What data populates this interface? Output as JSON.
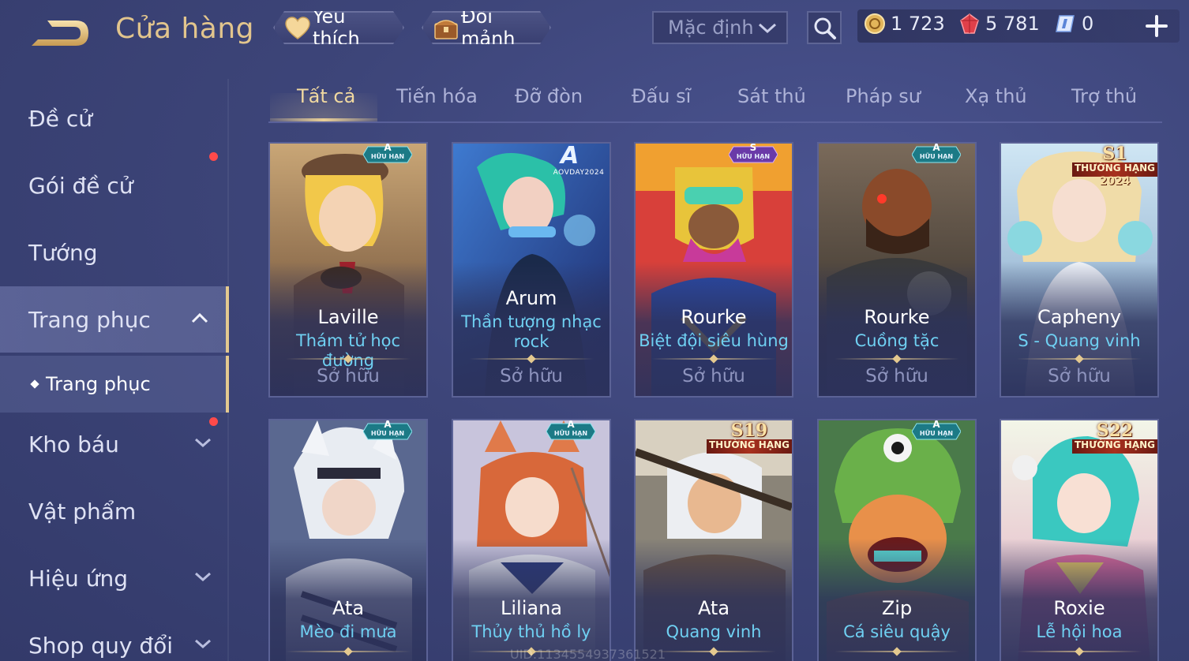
{
  "header": {
    "title": "Cửa hàng",
    "favorites_label": "Yêu thích",
    "exchange_label": "Đổi mảnh",
    "sort_value": "Mặc định",
    "currencies": {
      "gold": "1 723",
      "ruby": "5 781",
      "ticket": "0"
    }
  },
  "sidebar": {
    "items": [
      {
        "label": "Đề cử"
      },
      {
        "label": "Gói đề cử"
      },
      {
        "label": "Tướng"
      },
      {
        "label": "Trang phục"
      },
      {
        "label": "Kho báu"
      },
      {
        "label": "Vật phẩm"
      },
      {
        "label": "Hiệu ứng"
      },
      {
        "label": "Shop quy đổi"
      }
    ],
    "sub_item": "Trang phục"
  },
  "tabs": [
    {
      "label": "Tất cả"
    },
    {
      "label": "Tiến hóa"
    },
    {
      "label": "Đỡ đòn"
    },
    {
      "label": "Đấu sĩ"
    },
    {
      "label": "Sát thủ"
    },
    {
      "label": "Pháp sư"
    },
    {
      "label": "Xạ thủ"
    },
    {
      "label": "Trợ thủ"
    }
  ],
  "cards": [
    {
      "hero": "Laville",
      "skin": "Thám tử học đường",
      "status": "Sở hữu",
      "badge_tier": "A",
      "badge_text": "HỮU HẠN"
    },
    {
      "hero": "Arum",
      "skin": "Thần tượng nhạc rock",
      "status": "Sở hữu",
      "badge_event": "A",
      "badge_event_text": "AOVDAY2024"
    },
    {
      "hero": "Rourke",
      "skin": "Biệt đội siêu hùng",
      "status": "Sở hữu",
      "badge_tier": "S",
      "badge_text": "HỮU HẠN"
    },
    {
      "hero": "Rourke",
      "skin": "Cuồng tặc",
      "status": "Sở hữu",
      "badge_tier": "A",
      "badge_text": "HỮU HẠN"
    },
    {
      "hero": "Capheny",
      "skin": "S - Quang vinh",
      "status": "Sở hữu",
      "rank_season": "S1",
      "rank_text": "THƯỜNG HẠNG",
      "rank_year": "2024"
    },
    {
      "hero": "Ata",
      "skin": "Mèo đi mưa",
      "badge_tier": "A",
      "badge_text": "HỮU HẠN"
    },
    {
      "hero": "Liliana",
      "skin": "Thủy thủ hồ ly",
      "badge_tier": "A",
      "badge_text": "HỮU HẠN"
    },
    {
      "hero": "Ata",
      "skin": "Quang vinh",
      "rank_season": "S19",
      "rank_text": "THƯỜNG HẠNG"
    },
    {
      "hero": "Zip",
      "skin": "Cá siêu quậy",
      "badge_tier": "A",
      "badge_text": "HỮU HẠN"
    },
    {
      "hero": "Roxie",
      "skin": "Lễ hội hoa",
      "rank_season": "S22",
      "rank_text": "THƯỜNG HẠNG"
    }
  ],
  "footer": {
    "uid": "UID:1134554937361521"
  },
  "colors": {
    "background": "#3d4579",
    "accent_gold": "#e4c98f",
    "skin_name": "#6fd0f2",
    "notification": "#ff4a4a"
  },
  "icons": [
    "back-arrow-icon",
    "heart-icon",
    "chest-icon",
    "chevron-down-icon",
    "search-icon",
    "gold-coin-icon",
    "ruby-icon",
    "ticket-icon",
    "plus-icon",
    "chevron-up-icon"
  ]
}
